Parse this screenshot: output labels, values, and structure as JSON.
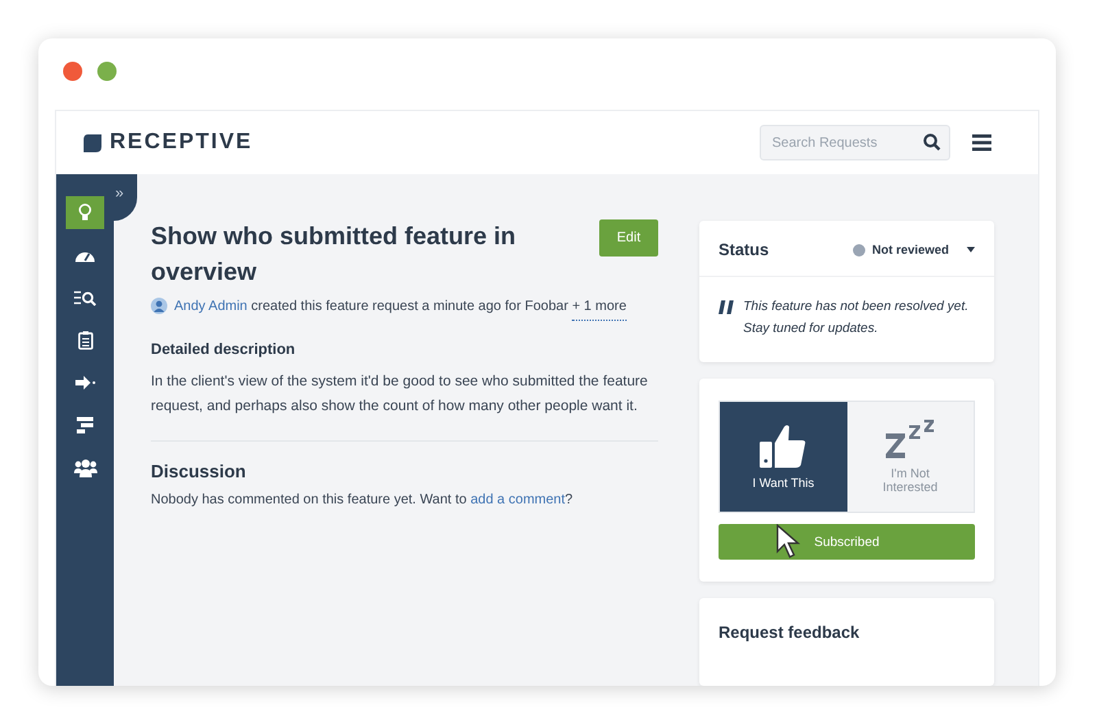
{
  "window": {
    "controls": [
      {
        "kind": "close"
      },
      {
        "kind": "maximize"
      }
    ]
  },
  "header": {
    "logo": "RECEPTIVE",
    "search": {
      "placeholder": "Search Requests"
    }
  },
  "sidebar": {
    "expand": "»",
    "items": [
      {
        "kind": "bulb",
        "selected": true
      },
      {
        "kind": "gauge",
        "selected": false
      },
      {
        "kind": "search-list",
        "selected": false
      },
      {
        "kind": "clipboard",
        "selected": false
      },
      {
        "kind": "arrow",
        "selected": false
      },
      {
        "kind": "tasks",
        "selected": false
      },
      {
        "kind": "users",
        "selected": false
      }
    ]
  },
  "feature": {
    "title": "Show who submitted feature in overview",
    "edit": "Edit",
    "author": "Andy Admin",
    "meta": " created this feature request a minute ago for Foobar ",
    "more": "+ 1 more",
    "description_heading": "Detailed description",
    "description": "In the client's view of the system it'd be good to see who submitted the feature request, and perhaps also show the count of how many other people want it.",
    "discussion_heading": "Discussion",
    "discussion_text": "Nobody has commented on this feature yet. Want to ",
    "discussion_link": "add a comment",
    "discussion_end": "?"
  },
  "status": {
    "heading": "Status",
    "value": "Not reviewed",
    "quote": "This feature has not been resolved yet. Stay tuned for updates."
  },
  "vote": {
    "options": [
      {
        "kind": "want",
        "label": "I Want This",
        "selected": true
      },
      {
        "kind": "not",
        "label": "I'm Not Interested",
        "selected": false
      }
    ],
    "subscribe": "Subscribed"
  },
  "feedback": {
    "heading": "Request feedback"
  }
}
